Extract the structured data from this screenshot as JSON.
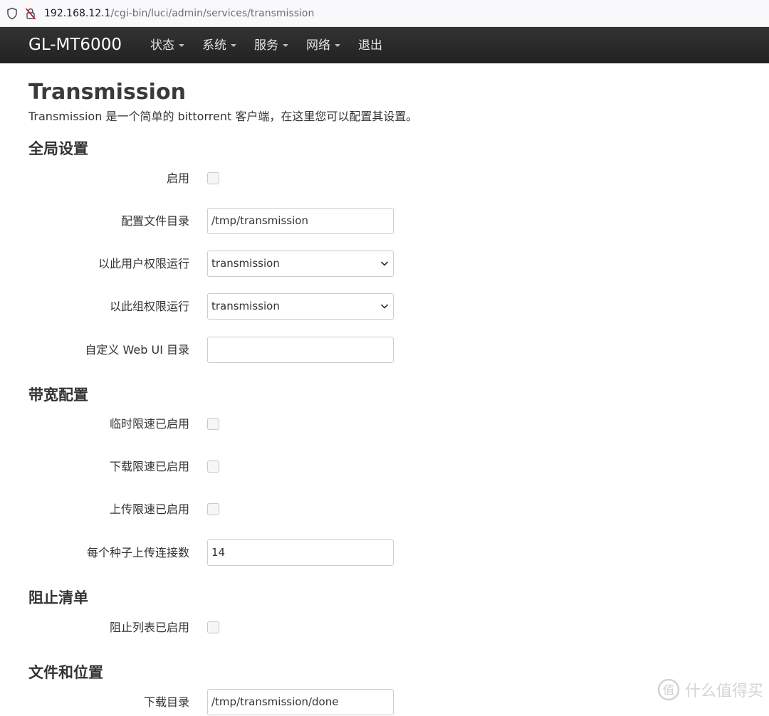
{
  "browser": {
    "url_host": "192.168.12.1",
    "url_path": "/cgi-bin/luci/admin/services/transmission"
  },
  "navbar": {
    "brand": "GL-MT6000",
    "menu": [
      {
        "label": "状态"
      },
      {
        "label": "系统"
      },
      {
        "label": "服务"
      },
      {
        "label": "网络"
      },
      {
        "label": "退出"
      }
    ]
  },
  "page": {
    "title": "Transmission",
    "description": "Transmission 是一个简单的 bittorrent 客户端，在这里您可以配置其设置。"
  },
  "sections": {
    "global": {
      "title": "全局设置",
      "enable_label": "启用",
      "enable_checked": false,
      "config_dir_label": "配置文件目录",
      "config_dir_value": "/tmp/transmission",
      "run_user_label": "以此用户权限运行",
      "run_user_value": "transmission",
      "run_group_label": "以此组权限运行",
      "run_group_value": "transmission",
      "webui_dir_label": "自定义 Web UI 目录",
      "webui_dir_value": ""
    },
    "bandwidth": {
      "title": "带宽配置",
      "alt_speed_label": "临时限速已启用",
      "alt_speed_checked": false,
      "download_limit_label": "下载限速已启用",
      "download_limit_checked": false,
      "upload_limit_label": "上传限速已启用",
      "upload_limit_checked": false,
      "upload_slots_label": "每个种子上传连接数",
      "upload_slots_value": "14"
    },
    "blocklist": {
      "title": "阻止清单",
      "blocklist_label": "阻止列表已启用",
      "blocklist_checked": false
    },
    "files": {
      "title": "文件和位置",
      "download_dir_label": "下载目录",
      "download_dir_value": "/tmp/transmission/done"
    }
  },
  "watermark": {
    "text": "什么值得买"
  }
}
